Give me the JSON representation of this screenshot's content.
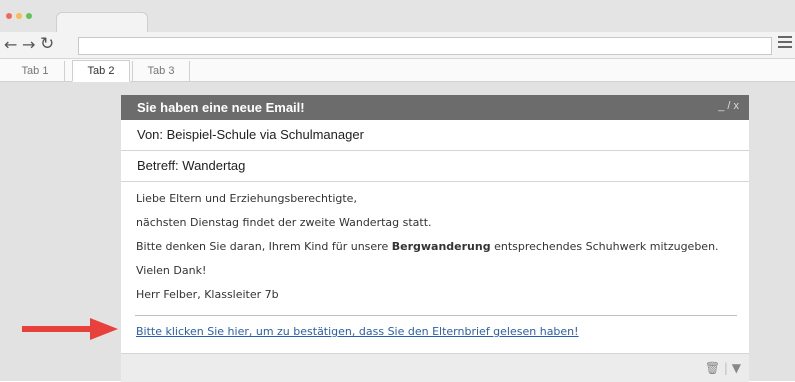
{
  "browser": {
    "url": "",
    "tabs": [
      "Tab 1",
      "Tab 2",
      "Tab 3"
    ],
    "active_tab": "Tab 2",
    "traffic_lights": [
      "#ef6a5e",
      "#f5be4f",
      "#5fc454"
    ],
    "icons": [
      "back-arrow-icon",
      "forward-arrow-icon",
      "reload-icon",
      "hamburger-menu-icon"
    ]
  },
  "email": {
    "title": "Sie haben eine neue Email!",
    "window_controls": "_ / x",
    "from": "Von: Beispiel-Schule via Schulmanager",
    "subject": "Betreff: Wandertag",
    "salutation": "Liebe Eltern und Erziehungsberechtigte,",
    "line1": "nächsten Dienstag findet der zweite Wandertag statt.",
    "line2_before": "Bitte denken Sie daran, Ihrem Kind für unsere ",
    "line2_bold": "Bergwanderung",
    "line2_after": " entsprechendes Schuhwerk mitzugeben.",
    "thanks": "Vielen Dank!",
    "signature": "Herr Felber, Klassleiter 7b",
    "link": "Bitte klicken Sie hier, um zu bestätigen, dass Sie den Elternbrief gelesen haben!",
    "footer_icons": [
      "trash-icon",
      "dropdown-icon"
    ]
  },
  "colors": {
    "header_bg": "#6c6c6c",
    "link": "#2a5db0",
    "arrow": "#e8403a"
  }
}
